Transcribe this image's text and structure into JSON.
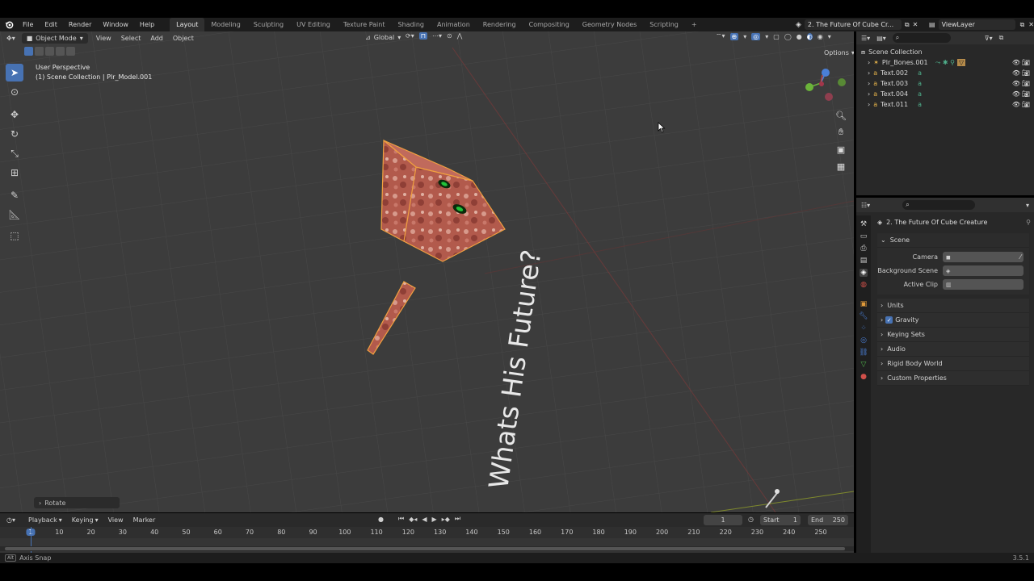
{
  "topbar": {
    "menus": [
      "File",
      "Edit",
      "Render",
      "Window",
      "Help"
    ],
    "workspaces": [
      "Layout",
      "Modeling",
      "Sculpting",
      "UV Editing",
      "Texture Paint",
      "Shading",
      "Animation",
      "Rendering",
      "Compositing",
      "Geometry Nodes",
      "Scripting"
    ],
    "add_tab": "+",
    "scene_name": "2. The Future Of Cube Cr...",
    "view_layer": "ViewLayer"
  },
  "viewport": {
    "mode": "Object Mode",
    "menus": [
      "View",
      "Select",
      "Add",
      "Object"
    ],
    "orientation": "Global",
    "options": "Options",
    "info_line1": "User Perspective",
    "info_line2": "(1) Scene Collection | Plr_Model.001",
    "text_object": "Whats His Future?",
    "last_op": "Rotate",
    "gizmo": {
      "x": "X",
      "y": "Y",
      "z": "Z"
    }
  },
  "outliner": {
    "root": "Scene Collection",
    "items": [
      "Plr_Bones.001",
      "Text.002",
      "Text.003",
      "Text.004",
      "Text.011"
    ]
  },
  "properties": {
    "title": "2. The Future Of Cube Creature",
    "scene_label": "Scene",
    "camera_label": "Camera",
    "bg_scene_label": "Background Scene",
    "active_clip_label": "Active Clip",
    "panels": [
      "Units",
      "Gravity",
      "Keying Sets",
      "Audio",
      "Rigid Body World",
      "Custom Properties"
    ]
  },
  "timeline": {
    "menus": [
      "Playback",
      "Keying",
      "View",
      "Marker"
    ],
    "current_frame": "1",
    "start_label": "Start",
    "start": "1",
    "end_label": "End",
    "end": "250",
    "ticks": [
      "1",
      "10",
      "20",
      "30",
      "40",
      "50",
      "60",
      "70",
      "80",
      "90",
      "100",
      "110",
      "120",
      "130",
      "140",
      "150",
      "160",
      "170",
      "180",
      "190",
      "200",
      "210",
      "220",
      "230",
      "240",
      "250"
    ]
  },
  "status": {
    "hint": "Axis Snap",
    "version": "3.5.1"
  },
  "colors": {
    "accent": "#4772b3",
    "viewport_bg": "#3c3c3c",
    "cube": "#b85c4e",
    "selection": "#f0a040"
  }
}
